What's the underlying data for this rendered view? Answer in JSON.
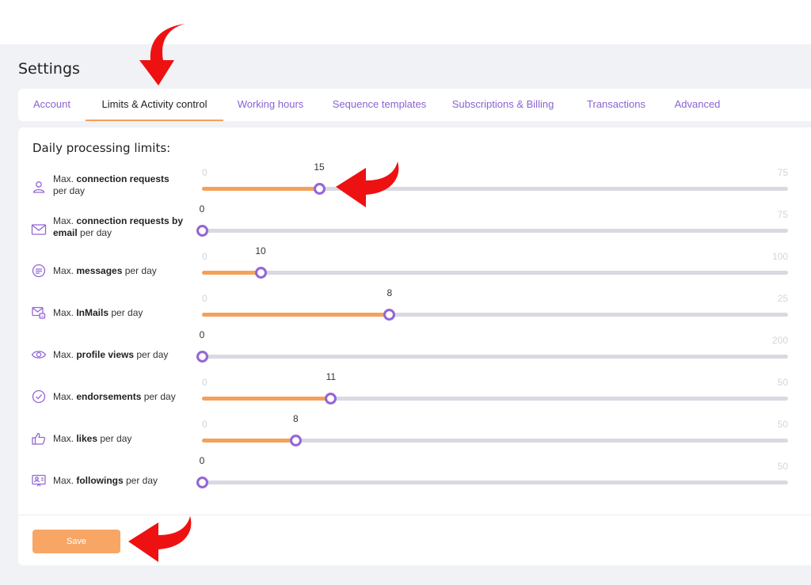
{
  "page": {
    "title": "Settings"
  },
  "tabs": [
    {
      "label": "Account",
      "active": false
    },
    {
      "label": "Limits & Activity control",
      "active": true
    },
    {
      "label": "Working hours",
      "active": false
    },
    {
      "label": "Sequence templates",
      "active": false
    },
    {
      "label": "Subscriptions & Billing",
      "active": false
    },
    {
      "label": "Transactions",
      "active": false
    },
    {
      "label": "Advanced",
      "active": false
    }
  ],
  "section": {
    "title": "Daily processing limits:"
  },
  "limits": [
    {
      "icon": "user-icon",
      "prefix": "Max. ",
      "bold": "connection requests",
      "suffix": " per day",
      "min": "0",
      "max": "75",
      "value": "15"
    },
    {
      "icon": "envelope-icon",
      "prefix": "Max. ",
      "bold": "connection requests by email",
      "suffix": " per day",
      "min": "0",
      "max": "75",
      "value": "0"
    },
    {
      "icon": "message-icon",
      "prefix": "Max. ",
      "bold": "messages",
      "suffix": " per day",
      "min": "0",
      "max": "100",
      "value": "10"
    },
    {
      "icon": "inmail-icon",
      "prefix": "Max. ",
      "bold": "InMails",
      "suffix": " per day",
      "min": "0",
      "max": "25",
      "value": "8"
    },
    {
      "icon": "eye-icon",
      "prefix": "Max. ",
      "bold": "profile views",
      "suffix": " per day",
      "min": "0",
      "max": "200",
      "value": "0"
    },
    {
      "icon": "check-circle-icon",
      "prefix": "Max. ",
      "bold": "endorsements",
      "suffix": " per day",
      "min": "0",
      "max": "50",
      "value": "11"
    },
    {
      "icon": "thumbs-up-icon",
      "prefix": "Max. ",
      "bold": "likes",
      "suffix": " per day",
      "min": "0",
      "max": "50",
      "value": "8"
    },
    {
      "icon": "follow-icon",
      "prefix": "Max. ",
      "bold": "followings",
      "suffix": " per day",
      "min": "0",
      "max": "50",
      "value": "0"
    }
  ],
  "actions": {
    "save_label": "Save"
  },
  "colors": {
    "accent": "#9466d6",
    "fill": "#f5a05b",
    "track": "#d8d9e2",
    "button": "#f8a665",
    "annotation_arrow": "#ee1111"
  }
}
